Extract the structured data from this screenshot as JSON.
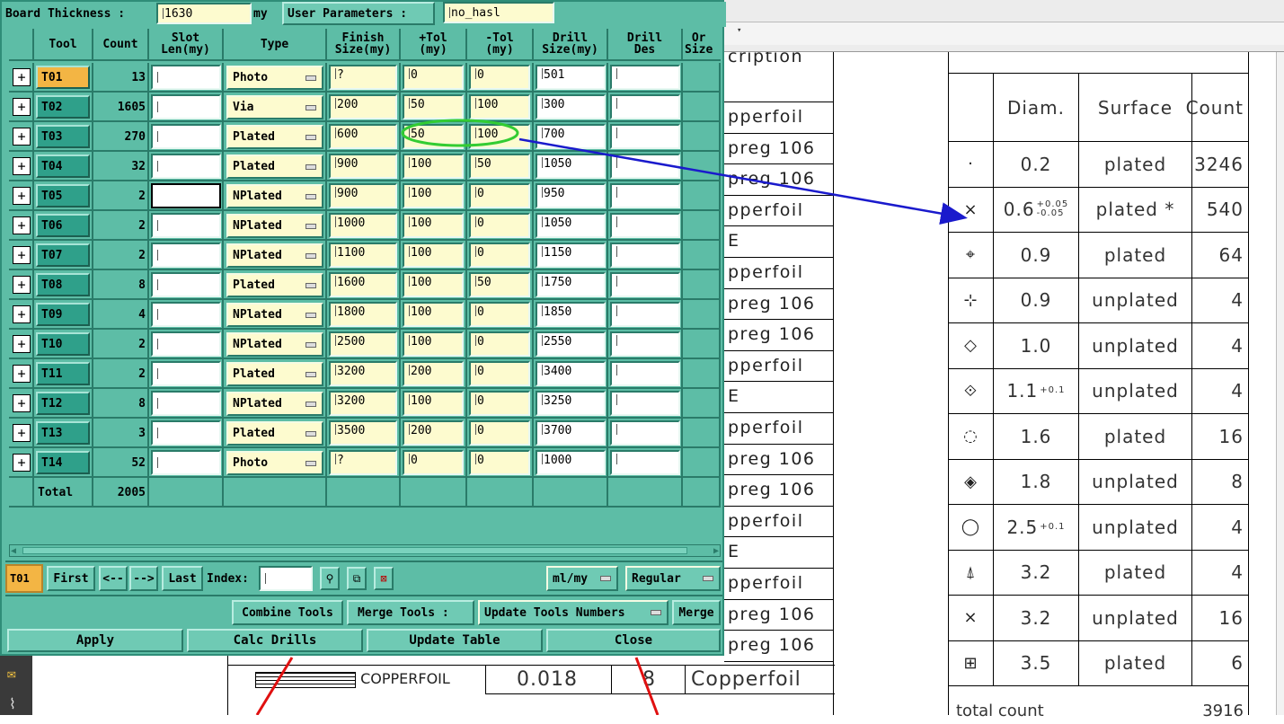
{
  "dialog": {
    "board_thickness_label": "Board Thickness :",
    "board_thickness_value": "1630",
    "board_thickness_unit": "my",
    "user_params_label": "User Parameters :",
    "user_params_value": "no_hasl",
    "columns": [
      "Tool",
      "Count",
      "Slot\nLen(my)",
      "Type",
      "Finish\nSize(my)",
      "+Tol\n(my)",
      "-Tol\n(my)",
      "Drill\nSize(my)",
      "Drill\nDes",
      "Or\nSize"
    ],
    "rows": [
      {
        "tool": "T01",
        "count": "13",
        "type": "Photo",
        "finish": "?",
        "ptol": "0",
        "ntol": "0",
        "drill": "501"
      },
      {
        "tool": "T02",
        "count": "1605",
        "type": "Via",
        "finish": "200",
        "ptol": "50",
        "ntol": "100",
        "drill": "300"
      },
      {
        "tool": "T03",
        "count": "270",
        "type": "Plated",
        "finish": "600",
        "ptol": "50",
        "ntol": "100",
        "drill": "700"
      },
      {
        "tool": "T04",
        "count": "32",
        "type": "Plated",
        "finish": "900",
        "ptol": "100",
        "ntol": "50",
        "drill": "1050"
      },
      {
        "tool": "T05",
        "count": "2",
        "type": "NPlated",
        "finish": "900",
        "ptol": "100",
        "ntol": "0",
        "drill": "950"
      },
      {
        "tool": "T06",
        "count": "2",
        "type": "NPlated",
        "finish": "1000",
        "ptol": "100",
        "ntol": "0",
        "drill": "1050"
      },
      {
        "tool": "T07",
        "count": "2",
        "type": "NPlated",
        "finish": "1100",
        "ptol": "100",
        "ntol": "0",
        "drill": "1150"
      },
      {
        "tool": "T08",
        "count": "8",
        "type": "Plated",
        "finish": "1600",
        "ptol": "100",
        "ntol": "50",
        "drill": "1750"
      },
      {
        "tool": "T09",
        "count": "4",
        "type": "NPlated",
        "finish": "1800",
        "ptol": "100",
        "ntol": "0",
        "drill": "1850"
      },
      {
        "tool": "T10",
        "count": "2",
        "type": "NPlated",
        "finish": "2500",
        "ptol": "100",
        "ntol": "0",
        "drill": "2550"
      },
      {
        "tool": "T11",
        "count": "2",
        "type": "Plated",
        "finish": "3200",
        "ptol": "200",
        "ntol": "0",
        "drill": "3400"
      },
      {
        "tool": "T12",
        "count": "8",
        "type": "NPlated",
        "finish": "3200",
        "ptol": "100",
        "ntol": "0",
        "drill": "3250"
      },
      {
        "tool": "T13",
        "count": "3",
        "type": "Plated",
        "finish": "3500",
        "ptol": "200",
        "ntol": "0",
        "drill": "3700"
      },
      {
        "tool": "T14",
        "count": "52",
        "type": "Photo",
        "finish": "?",
        "ptol": "0",
        "ntol": "0",
        "drill": "1000"
      }
    ],
    "total_label": "Total",
    "total_count": "2005",
    "nav": {
      "current_tool": "T01",
      "first": "First",
      "prev": "<--",
      "next": "-->",
      "last": "Last",
      "index_label": "Index:",
      "index_value": "",
      "units": "ml/my",
      "mode": "Regular"
    },
    "combine_tools": "Combine Tools",
    "merge_tools_label": "Merge Tools :",
    "merge_option": "Update Tools Numbers",
    "merge": "Merge",
    "apply": "Apply",
    "calc_drills": "Calc Drills",
    "update_table": "Update Table",
    "close": "Close"
  },
  "background": {
    "desc_header": "cription",
    "desc_rows": [
      "pperfoil",
      "preg 106",
      "preg 106",
      "pperfoil",
      "E",
      "pperfoil",
      "preg 106",
      "preg 106",
      "pperfoil",
      "E",
      "pperfoil",
      "preg 106",
      "preg 106",
      "pperfoil",
      "E",
      "pperfoil",
      "preg 106",
      "preg 106"
    ],
    "copperfoil_label": "COPPERFOIL",
    "thickness_value": "0.018",
    "layer_num": "8",
    "copperfoil_desc": "Copperfoil",
    "drill_table": {
      "headers": [
        "Diam.",
        "Surface",
        "Count"
      ],
      "rows": [
        {
          "sym": "·",
          "diam": "0.2",
          "sup_top": "",
          "sup_bot": "",
          "surface": "plated",
          "count": "3246"
        },
        {
          "sym": "×",
          "diam": "0.6",
          "sup_top": "+0.05",
          "sup_bot": "-0.05",
          "surface": "plated *",
          "count": "540"
        },
        {
          "sym": "⌖",
          "diam": "0.9",
          "sup_top": "",
          "sup_bot": "",
          "surface": "plated",
          "count": "64"
        },
        {
          "sym": "⊹",
          "diam": "0.9",
          "sup_top": "",
          "sup_bot": "",
          "surface": "unplated",
          "count": "4"
        },
        {
          "sym": "◇",
          "diam": "1.0",
          "sup_top": "",
          "sup_bot": "",
          "surface": "unplated",
          "count": "4"
        },
        {
          "sym": "⟐",
          "diam": "1.1",
          "sup_top": "+0.1",
          "sup_bot": "",
          "surface": "unplated",
          "count": "4"
        },
        {
          "sym": "◌",
          "diam": "1.6",
          "sup_top": "",
          "sup_bot": "",
          "surface": "plated",
          "count": "16"
        },
        {
          "sym": "◈",
          "diam": "1.8",
          "sup_top": "",
          "sup_bot": "",
          "surface": "unplated",
          "count": "8"
        },
        {
          "sym": "◯",
          "diam": "2.5",
          "sup_top": "+0.1",
          "sup_bot": "",
          "surface": "unplated",
          "count": "4"
        },
        {
          "sym": "⍋",
          "diam": "3.2",
          "sup_top": "",
          "sup_bot": "",
          "surface": "plated",
          "count": "4"
        },
        {
          "sym": "⨯",
          "diam": "3.2",
          "sup_top": "",
          "sup_bot": "",
          "surface": "unplated",
          "count": "16"
        },
        {
          "sym": "⊞",
          "diam": "3.5",
          "sup_top": "",
          "sup_bot": "",
          "surface": "plated",
          "count": "6"
        }
      ],
      "total_label": "total count",
      "total_value": "3916"
    }
  },
  "colors": {
    "dialog_bg": "#5dbda6",
    "field_bg": "#fdfbcf",
    "selected_tool": "#f3b544",
    "highlight_ellipse": "#33cc33",
    "arrow": "#1a1acc",
    "red_lines": "#e01010"
  }
}
